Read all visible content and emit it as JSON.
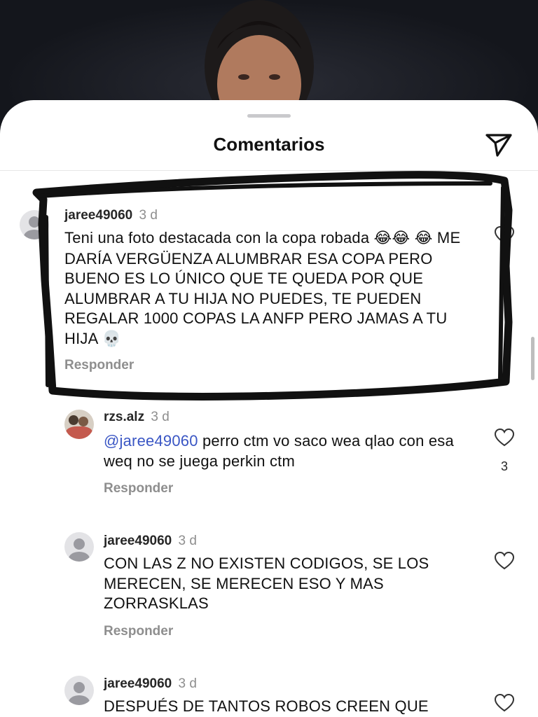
{
  "sheet": {
    "title": "Comentarios"
  },
  "comments": [
    {
      "username": "jaree49060",
      "time": "3 d",
      "text_line1": "Teni una foto destacada con la copa robada ",
      "emoji_laugh": "😂😂",
      "text_line2_emoji": "😂",
      "text_rest": " ME DARÍA VERGÜENZA ALUMBRAR ESA COPA PERO BUENO ES LO ÚNICO QUE TE QUEDA POR QUE ALUMBRAR A TU HIJA NO PUEDES, TE PUEDEN REGALAR 1000 COPAS LA ANFP PERO JAMAS A TU HIJA ",
      "emoji_skull": "💀",
      "reply_label": "Responder"
    },
    {
      "username": "rzs.alz",
      "time": "3 d",
      "mention": "@jaree49060",
      "text": " perro ctm vo saco wea qlao con esa weq no se juega perkin ctm",
      "likes": "3",
      "reply_label": "Responder"
    },
    {
      "username": "jaree49060",
      "time": "3 d",
      "text": "CON LAS Z NO EXISTEN CODIGOS, SE LOS MERECEN, SE MERECEN ESO Y MAS ZORRASKLAS",
      "reply_label": "Responder"
    },
    {
      "username": "jaree49060",
      "time": "3 d",
      "text": "DESPUÉS DE TANTOS ROBOS CREEN QUE"
    }
  ],
  "annotation": {
    "color": "#111111"
  }
}
